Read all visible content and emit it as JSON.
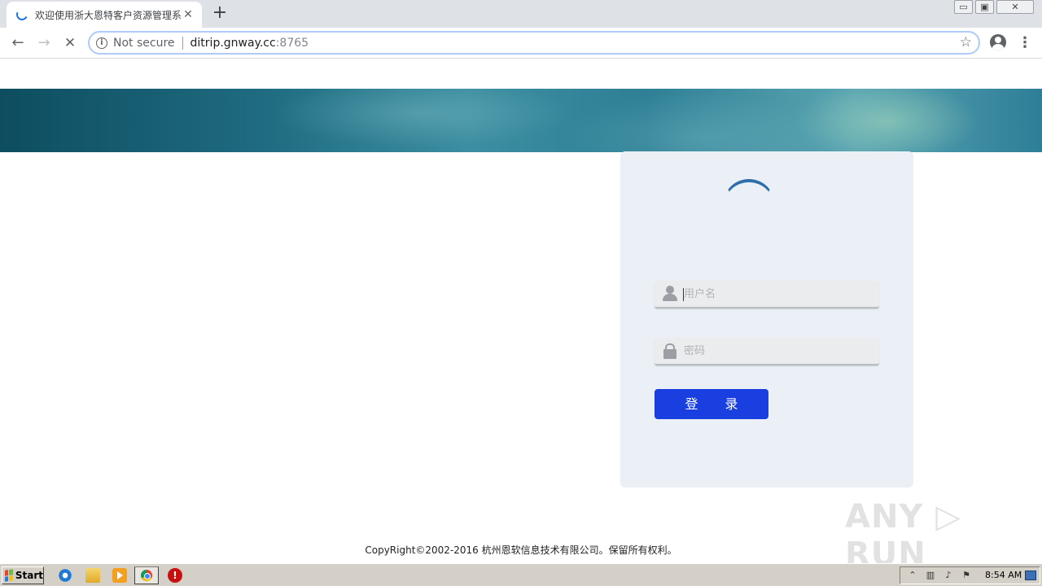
{
  "browser": {
    "tab": {
      "title": "欢迎使用浙大恩特客户资源管理系统",
      "close": "✕"
    },
    "new_tab": "+",
    "window_controls": {
      "minimize": "▭",
      "restore": "▣",
      "close": "✕"
    },
    "nav": {
      "back": "←",
      "forward": "→",
      "stop": "✕"
    },
    "omnibox": {
      "info": "i",
      "security_label": "Not secure",
      "url_host": "ditrip.gnway.cc",
      "url_port": ":8765",
      "star": "☆"
    },
    "menu": "⋮"
  },
  "page": {
    "username_placeholder": "用户名",
    "password_placeholder": "密码",
    "login_button": "登 录",
    "copyright": "CopyRight©2002-2016 杭州恩软信息技术有限公司。保留所有权利。",
    "watermark": "ANY ▷ RUN"
  },
  "taskbar": {
    "start": "Start",
    "tray_icons": [
      "⌃",
      "▥",
      "♪",
      "⚑"
    ],
    "clock": "8:54 AM"
  }
}
